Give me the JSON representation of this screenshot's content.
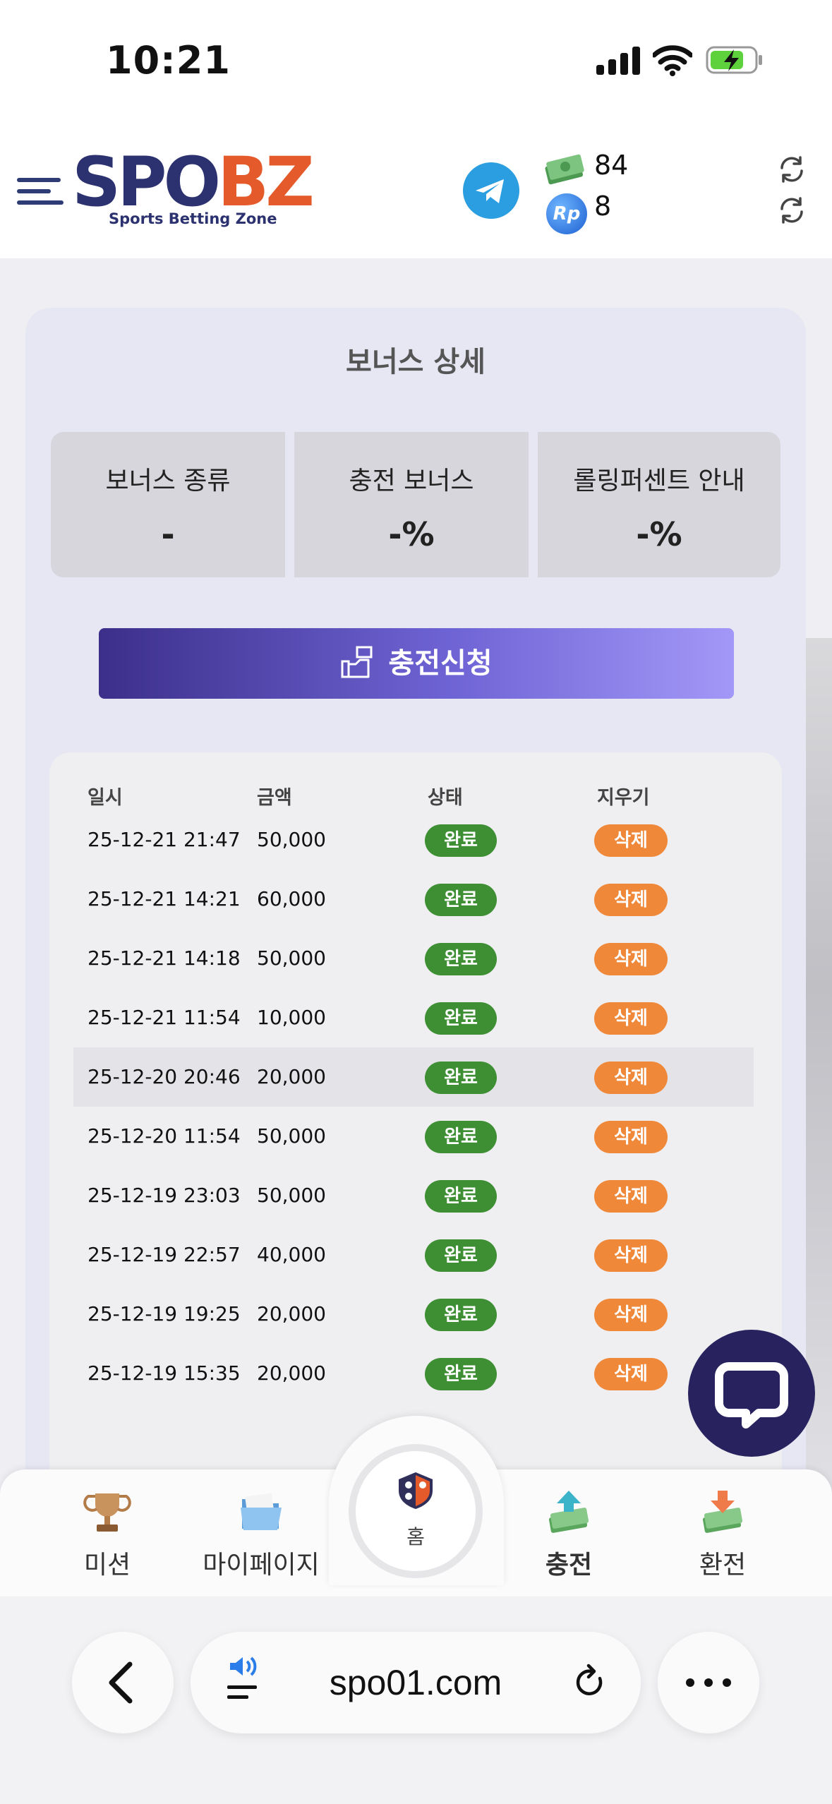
{
  "status_bar": {
    "time": "10:21"
  },
  "header": {
    "logo_main_left": "SPO",
    "logo_main_right": "BZ",
    "logo_sub": "Sports Betting Zone",
    "money_balance": "84",
    "rp_label": "Rp",
    "rp_balance": "8"
  },
  "bonus": {
    "title": "보너스 상세",
    "cards": [
      {
        "label": "보너스 종류",
        "value": "-"
      },
      {
        "label": "충전 보너스",
        "value": "-%"
      },
      {
        "label": "롤링퍼센트 안내",
        "value": "-%"
      }
    ],
    "charge_button": "충전신청"
  },
  "history": {
    "headers": {
      "date": "일시",
      "amount": "금액",
      "status": "상태",
      "delete": "지우기"
    },
    "rows": [
      {
        "date": "25-12-21 21:47",
        "amount": "50,000",
        "status": "완료",
        "delete": "삭제"
      },
      {
        "date": "25-12-21 14:21",
        "amount": "60,000",
        "status": "완료",
        "delete": "삭제"
      },
      {
        "date": "25-12-21 14:18",
        "amount": "50,000",
        "status": "완료",
        "delete": "삭제"
      },
      {
        "date": "25-12-21 11:54",
        "amount": "10,000",
        "status": "완료",
        "delete": "삭제"
      },
      {
        "date": "25-12-20 20:46",
        "amount": "20,000",
        "status": "완료",
        "delete": "삭제"
      },
      {
        "date": "25-12-20 11:54",
        "amount": "50,000",
        "status": "완료",
        "delete": "삭제"
      },
      {
        "date": "25-12-19 23:03",
        "amount": "50,000",
        "status": "완료",
        "delete": "삭제"
      },
      {
        "date": "25-12-19 22:57",
        "amount": "40,000",
        "status": "완료",
        "delete": "삭제"
      },
      {
        "date": "25-12-19 19:25",
        "amount": "20,000",
        "status": "완료",
        "delete": "삭제"
      },
      {
        "date": "25-12-19 15:35",
        "amount": "20,000",
        "status": "완료",
        "delete": "삭제"
      }
    ]
  },
  "bottom_nav": {
    "mission": "미션",
    "mypage": "마이페이지",
    "home": "홈",
    "deposit": "충전",
    "withdraw": "환전"
  },
  "browser": {
    "url": "spo01.com"
  },
  "colors": {
    "brand_navy": "#2c3170",
    "brand_orange": "#e45a2a",
    "status_done": "#3e8f33",
    "delete_orange": "#f0883a",
    "button_purple": "#6e63d4"
  }
}
